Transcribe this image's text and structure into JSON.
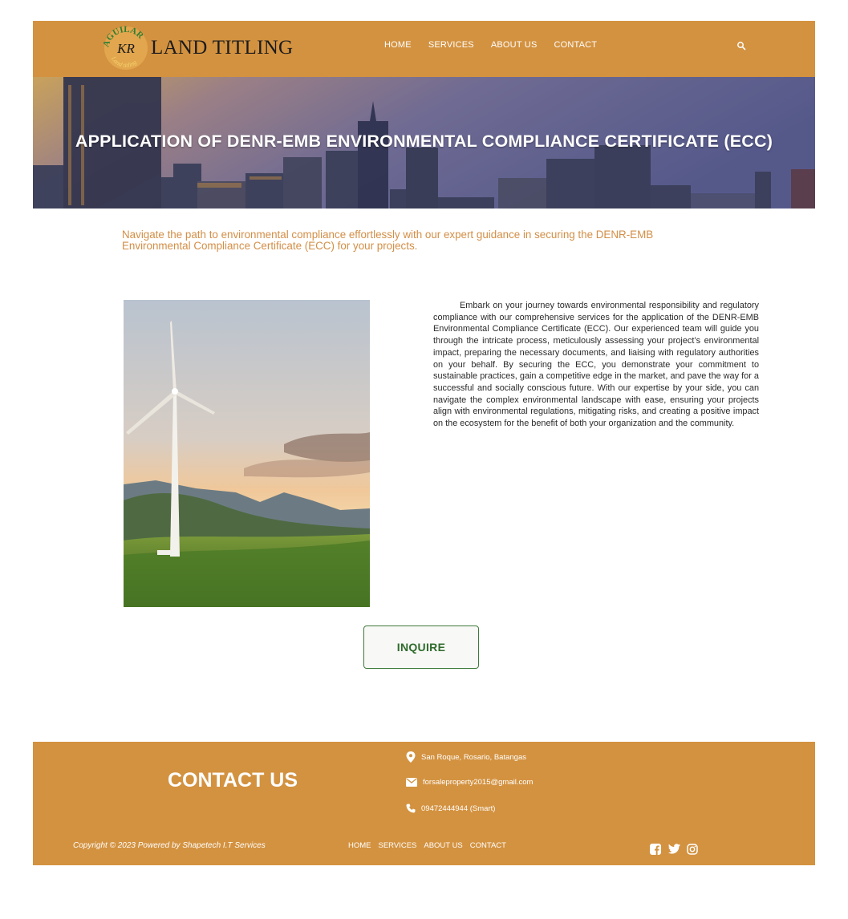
{
  "header": {
    "logo_text": "LAND TITLING",
    "logo_ring_text": "AGUILAR",
    "logo_monogram": "KR",
    "logo_sub": "Land titling",
    "nav": [
      "HOME",
      "SERVICES",
      "ABOUT US",
      "CONTACT"
    ]
  },
  "hero": {
    "title": "APPLICATION OF DENR-EMB ENVIRONMENTAL COMPLIANCE CERTIFICATE (ECC)"
  },
  "intro": "Navigate the path to environmental compliance effortlessly with our expert guidance in securing the DENR-EMB Environmental Compliance Certificate (ECC) for your projects.",
  "body": "Embark on your journey towards environmental responsibility and regulatory compliance with our comprehensive services for the application of the DENR-EMB Environmental Compliance Certificate (ECC). Our experienced team will guide you through the intricate process, meticulously assessing your project’s environmental impact, preparing the necessary documents, and liaising with regulatory authorities on your behalf. By securing the ECC, you demonstrate your commitment to sustainable practices, gain a competitive edge in the market, and pave the way for a successful and socially conscious future. With our expertise by your side, you can navigate the complex environmental landscape with ease, ensuring your projects align with environmental regulations, mitigating risks, and creating a positive impact on the ecosystem for the benefit of both your organization and the community.",
  "cta": "INQUIRE",
  "footer": {
    "contact_title": "CONTACT US",
    "address": "San Roque, Rosario, Batangas",
    "email": "forsaleproperty2015@gmail.com",
    "phone": "09472444944 (Smart)",
    "copyright": "Copyright © 2023 Powered by Shapetech I.T Services",
    "nav": [
      "HOME",
      "SERVICES",
      "ABOUT US",
      "CONTACT"
    ],
    "socials": [
      "facebook-icon",
      "twitter-icon",
      "instagram-icon"
    ]
  },
  "colors": {
    "brand": "#d39240",
    "intro_text": "#d38e46",
    "cta_green": "#2f6b2c"
  }
}
